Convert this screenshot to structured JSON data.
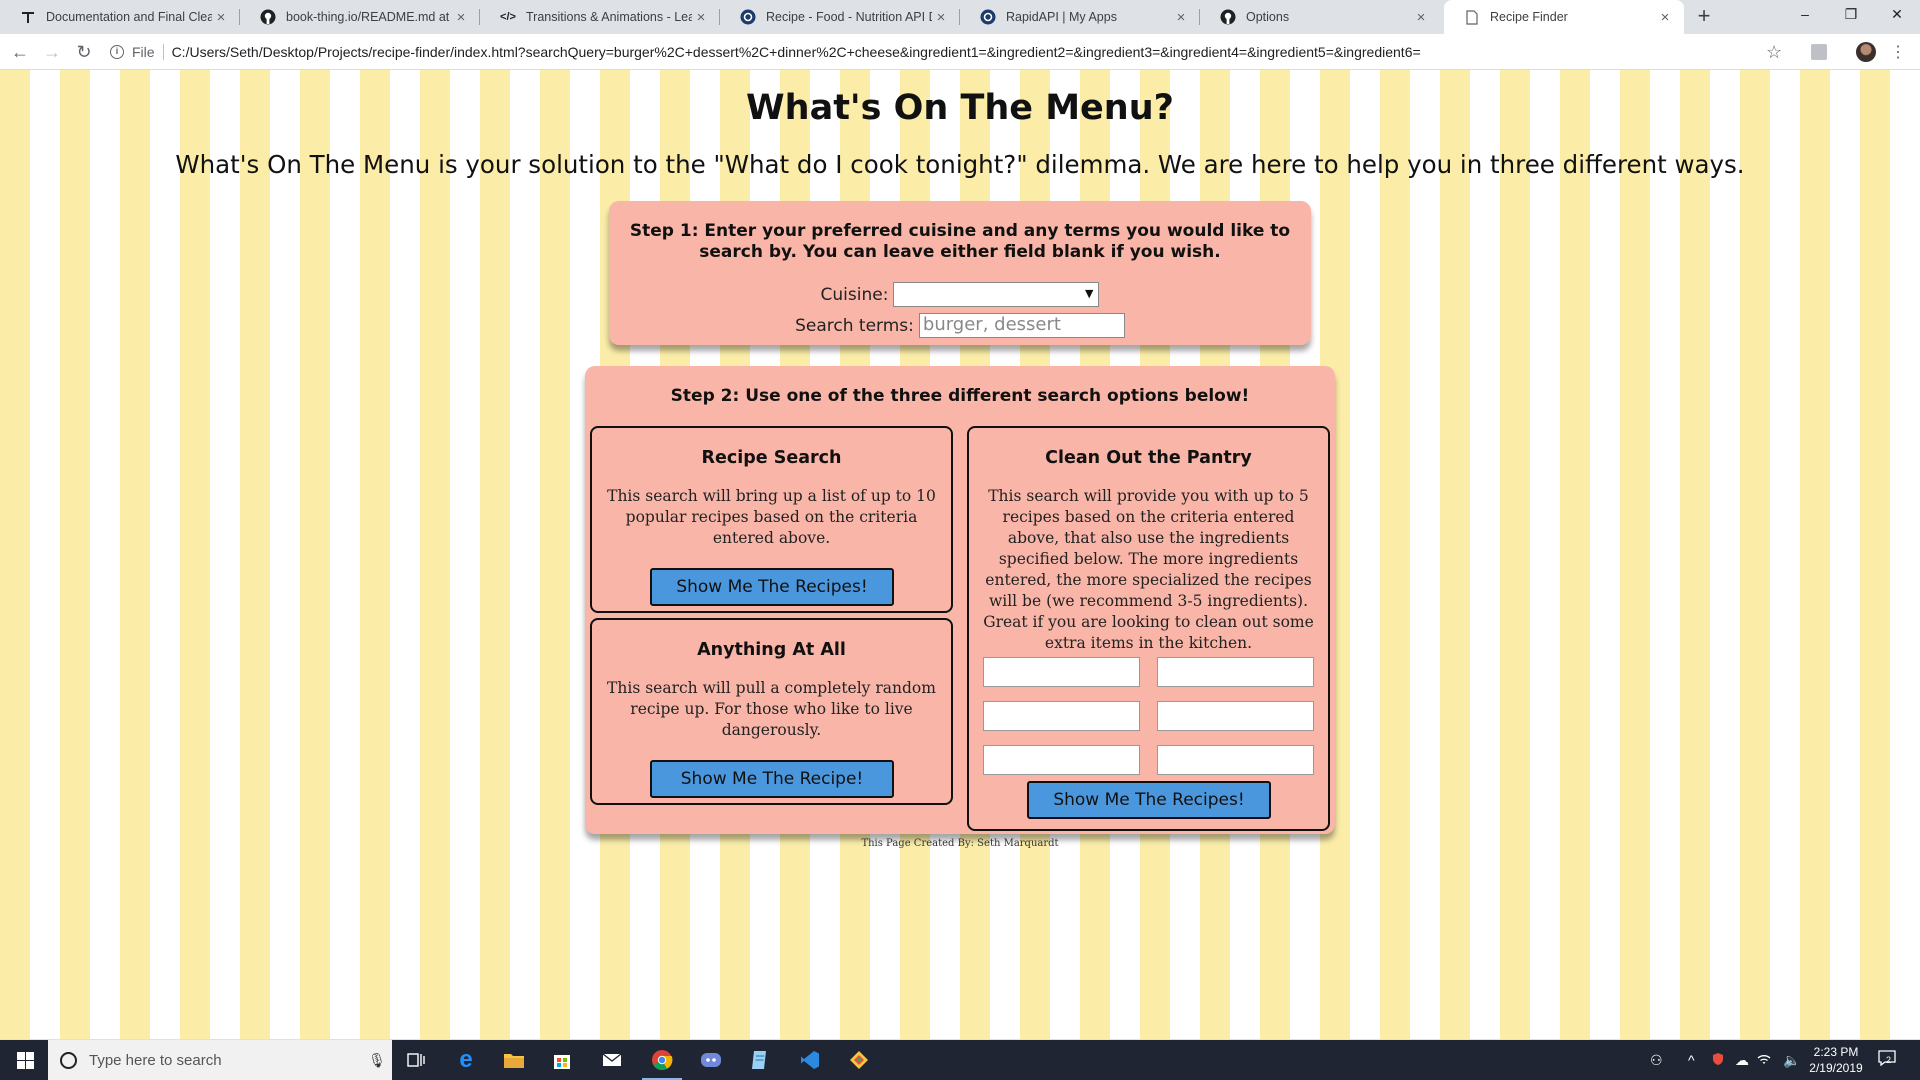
{
  "browser": {
    "tabs": [
      {
        "title": "Documentation and Final Cleanu",
        "icon": "typeform-icon"
      },
      {
        "title": "book-thing.io/README.md at m",
        "icon": "github-icon"
      },
      {
        "title": "Transitions & Animations - Learn",
        "icon": "code-icon"
      },
      {
        "title": "Recipe - Food - Nutrition API Do",
        "icon": "rapidapi-icon"
      },
      {
        "title": "RapidAPI | My Apps",
        "icon": "rapidapi-icon"
      },
      {
        "title": "Options",
        "icon": "github-icon"
      },
      {
        "title": "Recipe Finder",
        "icon": "page-icon",
        "active": true
      }
    ],
    "address": {
      "scheme_label": "File",
      "url": "C:/Users/Seth/Desktop/Projects/recipe-finder/index.html?searchQuery=burger%2C+dessert%2C+dinner%2C+cheese&ingredient1=&ingredient2=&ingredient3=&ingredient4=&ingredient5=&ingredient6="
    }
  },
  "page": {
    "title": "What's On The Menu?",
    "intro": "What's On The Menu is your solution to the \"What do I cook tonight?\" dilemma. We are here to help you in three different ways.",
    "step1": {
      "title": "Step 1: Enter your preferred cuisine and any terms you would like to search by. You can leave either field blank if you wish.",
      "cuisine_label": "Cuisine:",
      "cuisine_value": "",
      "search_label": "Search terms:",
      "search_placeholder": "burger, dessert"
    },
    "step2": {
      "title": "Step 2: Use one of the three different search options below!",
      "recipe_search": {
        "title": "Recipe Search",
        "description": "This search will bring up a list of up to 10 popular recipes based on the criteria entered above.",
        "button": "Show Me The Recipes!"
      },
      "anything": {
        "title": "Anything At All",
        "description": "This search will pull a completely random recipe up. For those who like to live dangerously.",
        "button": "Show Me The Recipe!"
      },
      "pantry": {
        "title": "Clean Out the Pantry",
        "description": "This search will provide you with up to 5 recipes based on the criteria entered above, that also use the ingredients specified below. The more ingredients entered, the more specialized the recipes will be (we recommend 3-5 ingredients). Great if you are looking to clean out some extra items in the kitchen.",
        "ingredients": [
          "",
          "",
          "",
          "",
          "",
          ""
        ],
        "button": "Show Me The Recipes!"
      }
    },
    "footer": "This Page Created By: Seth Marquardt",
    "colors": {
      "stripe": "#fbeda8",
      "panel": "#f9b6a8",
      "button": "#4a97dd"
    }
  },
  "taskbar": {
    "search_placeholder": "Type here to search",
    "time": "2:23 PM",
    "date": "2/19/2019",
    "notification_count": "2"
  }
}
